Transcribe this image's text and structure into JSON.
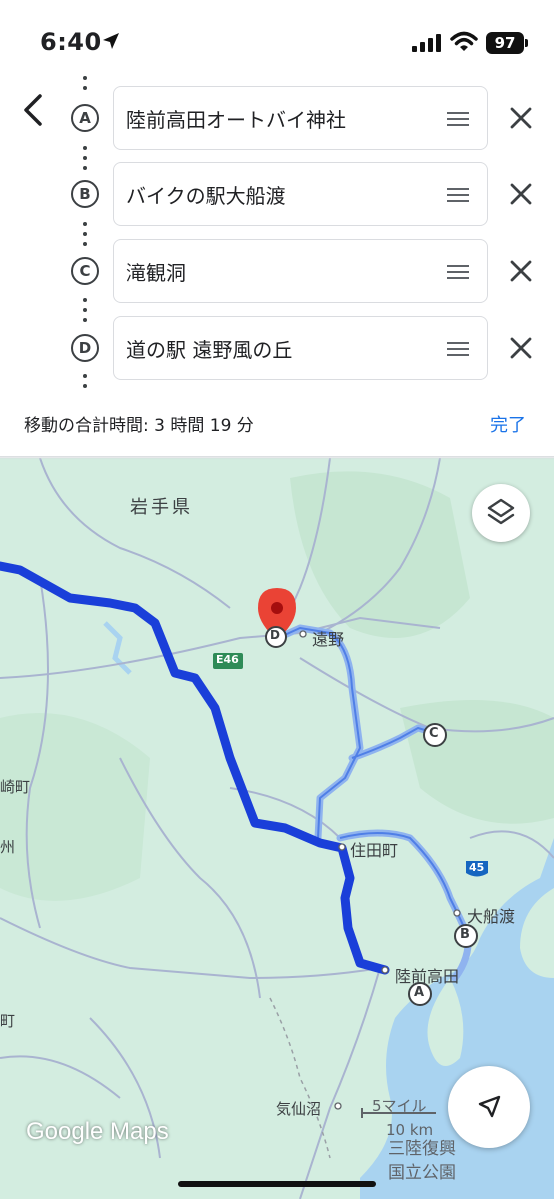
{
  "status_bar": {
    "time": "6:40",
    "battery": "97"
  },
  "waypoints": [
    {
      "letter": "A",
      "name": "陸前高田オートバイ神社"
    },
    {
      "letter": "B",
      "name": "バイクの駅大船渡"
    },
    {
      "letter": "C",
      "name": "滝観洞"
    },
    {
      "letter": "D",
      "name": "道の駅 遠野風の丘"
    }
  ],
  "summary": {
    "total_time": "移動の合計時間: 3 時間 19 分",
    "done_label": "完了"
  },
  "map": {
    "labels": {
      "prefecture": "岩手県",
      "tono": "遠野",
      "sumita": "住田町",
      "ofunato": "大船渡",
      "rikuzentakata": "陸前高田",
      "kesennuma": "気仙沼",
      "park_line1": "三陸復興",
      "park_line2": "国立公園",
      "edge_left1": "崎町",
      "edge_left2": "州",
      "edge_left3": "町",
      "route_e46": "E46",
      "route_45": "45"
    },
    "markers": {
      "a": "A",
      "b": "B",
      "c": "C",
      "d": "D"
    },
    "scale": {
      "miles": "5マイル",
      "km": "10 km"
    },
    "logo": "Google Maps",
    "colors": {
      "land": "#d3ede0",
      "water": "#a9d3f0",
      "route_primary": "#1a3fd9",
      "route_alt": "#8fb3ef",
      "pin": "#ea4335"
    }
  }
}
